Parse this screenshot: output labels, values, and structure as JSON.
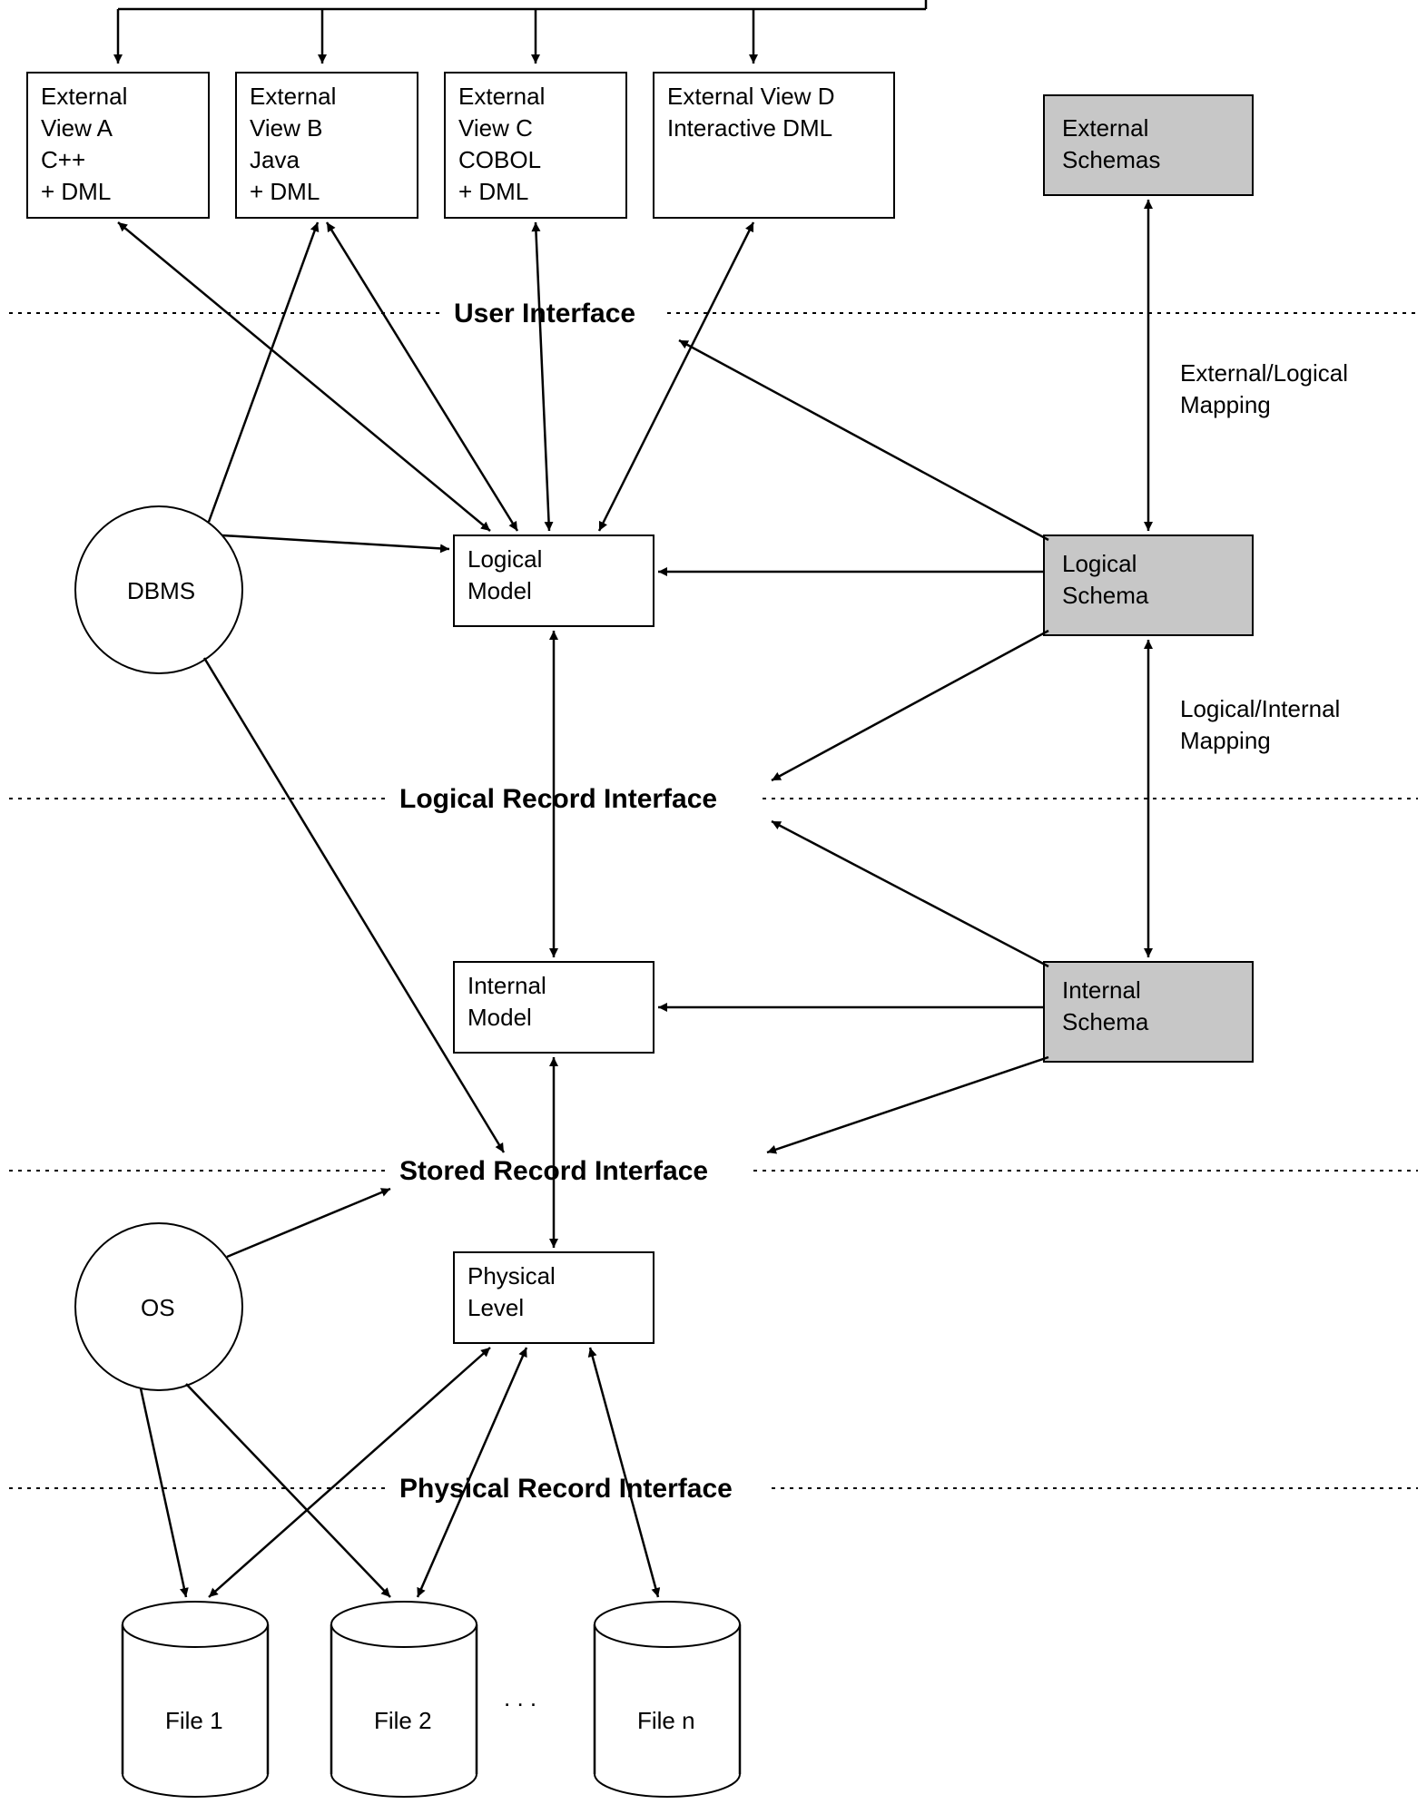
{
  "views": {
    "a": {
      "l1": "External",
      "l2": "View A",
      "l3": "C++",
      "l4": "+ DML"
    },
    "b": {
      "l1": "External",
      "l2": "View B",
      "l3": "Java",
      "l4": "+ DML"
    },
    "c": {
      "l1": "External",
      "l2": "View C",
      "l3": "COBOL",
      "l4": "+ DML"
    },
    "d": {
      "l1": "External View D",
      "l2": "Interactive DML"
    }
  },
  "schemas": {
    "external": {
      "l1": "External",
      "l2": "Schemas"
    },
    "logical": {
      "l1": "Logical",
      "l2": "Schema"
    },
    "internal": {
      "l1": "Internal",
      "l2": "Schema"
    }
  },
  "models": {
    "logical": {
      "l1": "Logical",
      "l2": "Model"
    },
    "internal": {
      "l1": "Internal",
      "l2": "Model"
    },
    "physical": {
      "l1": "Physical",
      "l2": "Level"
    }
  },
  "circles": {
    "dbms": "DBMS",
    "os": "OS"
  },
  "interfaces": {
    "user": "User Interface",
    "logrec": "Logical Record Interface",
    "storec": "Stored Record Interface",
    "phyrec": "Physical Record Interface"
  },
  "mappings": {
    "extLog": {
      "l1": "External/Logical",
      "l2": "Mapping"
    },
    "logInt": {
      "l1": "Logical/Internal",
      "l2": "Mapping"
    }
  },
  "files": {
    "f1": "File 1",
    "f2": "File 2",
    "fn": "File n",
    "ellipsis": ". . ."
  }
}
